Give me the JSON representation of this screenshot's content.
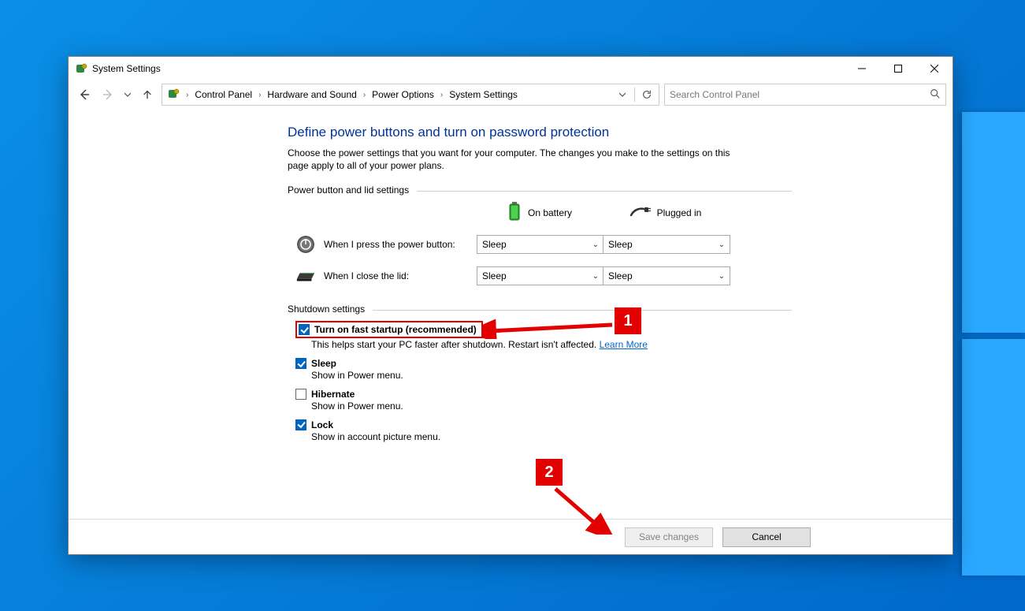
{
  "titlebar": {
    "title": "System Settings"
  },
  "breadcrumbs": {
    "b0": "",
    "b1": "Control Panel",
    "b2": "Hardware and Sound",
    "b3": "Power Options",
    "b4": "System Settings"
  },
  "search": {
    "placeholder": "Search Control Panel"
  },
  "page": {
    "title": "Define power buttons and turn on password protection",
    "description": "Choose the power settings that you want for your computer. The changes you make to the settings on this page apply to all of your power plans."
  },
  "section1": {
    "header": "Power button and lid settings",
    "col_battery": "On battery",
    "col_plugged": "Plugged in",
    "row_power": "When I press the power button:",
    "row_lid": "When I close the lid:",
    "sel_power_battery": "Sleep",
    "sel_power_plugged": "Sleep",
    "sel_lid_battery": "Sleep",
    "sel_lid_plugged": "Sleep"
  },
  "section2": {
    "header": "Shutdown settings",
    "items": [
      {
        "label": "Turn on fast startup (recommended)",
        "sub": "This helps start your PC faster after shutdown. Restart isn't affected. ",
        "link": "Learn More",
        "checked": true
      },
      {
        "label": "Sleep",
        "sub": "Show in Power menu.",
        "checked": true
      },
      {
        "label": "Hibernate",
        "sub": "Show in Power menu.",
        "checked": false
      },
      {
        "label": "Lock",
        "sub": "Show in account picture menu.",
        "checked": true
      }
    ]
  },
  "footer": {
    "save": "Save changes",
    "cancel": "Cancel"
  },
  "annotations": {
    "a1": "1",
    "a2": "2"
  }
}
